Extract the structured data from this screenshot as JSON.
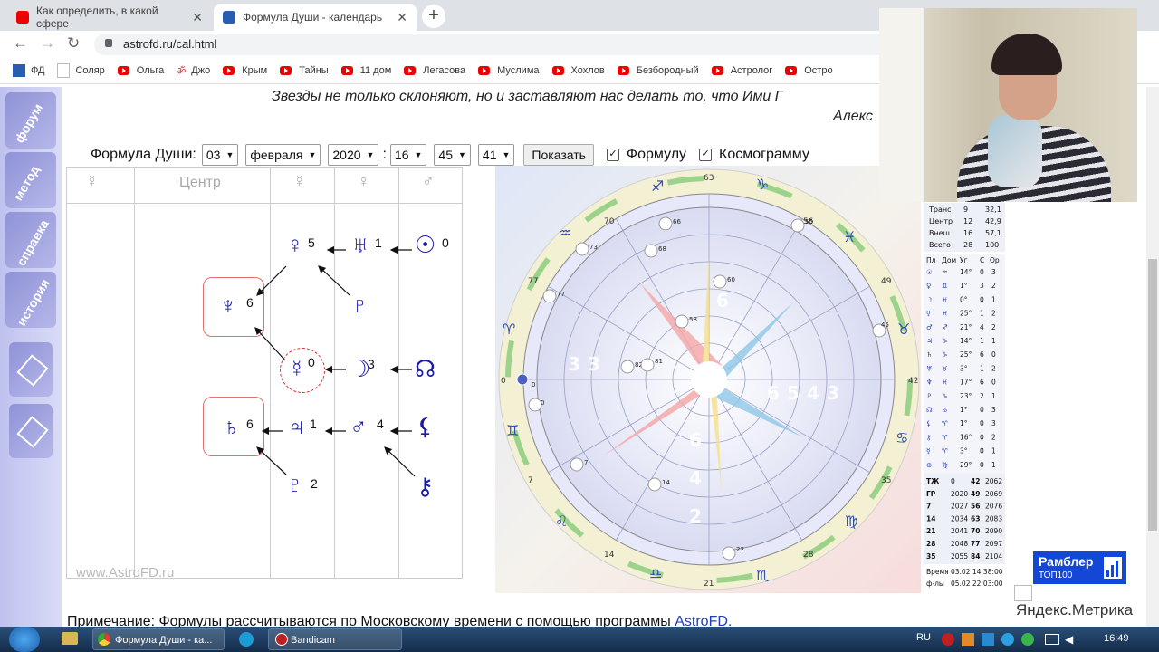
{
  "tabs": [
    {
      "label": "Как определить, в какой сфере",
      "close": "✕"
    },
    {
      "label": "Формула Души - календарь",
      "close": "✕"
    }
  ],
  "new_tab": "+",
  "address": "astrofd.ru/cal.html",
  "bookmarks": [
    "ФД",
    "Соляр",
    "Ольга",
    "Джо",
    "Крым",
    "Тайны",
    "11 дом",
    "Легасова",
    "Муслима",
    "Хохлов",
    "Безбородный",
    "Астролог",
    "Остро"
  ],
  "nav": [
    "форум",
    "метод",
    "справка",
    "история"
  ],
  "motto": {
    "line1": "Звезды не только склоняют, но и заставляют нас делать то, что Ими Г",
    "line2": "Алекс"
  },
  "form": {
    "label": "Формула Души:",
    "day": "03",
    "month": "февраля",
    "year": "2020",
    "hour": "16",
    "minute": "45",
    "second": "41",
    "colon": ":",
    "show_button": "Показать",
    "check_formula": "Формулу",
    "check_cosmo": "Космограмму"
  },
  "grid": {
    "headers": [
      "☿",
      "Центр",
      "☿",
      "♀",
      "♂"
    ],
    "cells": [
      {
        "g": "♀",
        "n": "5"
      },
      {
        "g": "♅",
        "n": "1"
      },
      {
        "g": "☉",
        "n": "0"
      },
      {
        "g": "♆",
        "n": "6"
      },
      {
        "g": "♇",
        "n": ""
      },
      {
        "g": "☿",
        "n": "0"
      },
      {
        "g": "☽",
        "n": "3"
      },
      {
        "g": "☊",
        "n": ""
      },
      {
        "g": "♄",
        "n": "6"
      },
      {
        "g": "♃",
        "n": "1"
      },
      {
        "g": "♂",
        "n": "4"
      },
      {
        "g": "⚸",
        "n": ""
      },
      {
        "g": "♇",
        "n": "2"
      },
      {
        "g": "⚷",
        "n": ""
      }
    ],
    "watermark": "www.AstroFD.ru"
  },
  "chart": {
    "signs": [
      "♐",
      "♑",
      "♒",
      "♓",
      "♈",
      "♉",
      "♊",
      "♋",
      "♌",
      "♍",
      "♎",
      "♏"
    ],
    "degrees": [
      "63",
      "70",
      "77",
      "0",
      "7",
      "14",
      "21",
      "28",
      "35",
      "42",
      "49",
      "56"
    ],
    "numbers": [
      "6",
      "5",
      "4",
      "3",
      "2"
    ],
    "planet_labels": [
      "66",
      "73",
      "68",
      "60",
      "77",
      "58",
      "82",
      "81",
      "0",
      "0",
      "7",
      "14",
      "22",
      "45",
      "55"
    ]
  },
  "stats": {
    "top": [
      [
        "Транс",
        "9",
        "32,1"
      ],
      [
        "Центр",
        "12",
        "42,9"
      ],
      [
        "Внеш",
        "16",
        "57,1"
      ],
      [
        "Всего",
        "28",
        "100"
      ]
    ],
    "header": [
      "Пл",
      "Дом",
      "Уг",
      "С",
      "Ор"
    ],
    "planets": [
      [
        "☉",
        "♒",
        "14°",
        "0",
        "3"
      ],
      [
        "♀",
        "♊",
        "1°",
        "3",
        "2"
      ],
      [
        "☽",
        "♓",
        "0°",
        "0",
        "1"
      ],
      [
        "☿",
        "♓",
        "25°",
        "1",
        "2"
      ],
      [
        "♂",
        "♐",
        "21°",
        "4",
        "2"
      ],
      [
        "♃",
        "♑",
        "14°",
        "1",
        "1"
      ],
      [
        "♄",
        "♑",
        "25°",
        "6",
        "0"
      ],
      [
        "♅",
        "♉",
        "3°",
        "1",
        "2"
      ],
      [
        "♆",
        "♓",
        "17°",
        "6",
        "0"
      ],
      [
        "♇",
        "♑",
        "23°",
        "2",
        "1"
      ],
      [
        "☊",
        "♋",
        "1°",
        "0",
        "3"
      ],
      [
        "⚸",
        "♈",
        "1°",
        "0",
        "3"
      ],
      [
        "⚷",
        "♈",
        "16°",
        "0",
        "2"
      ],
      [
        "☿",
        "♈",
        "3°",
        "0",
        "1"
      ],
      [
        "⊕",
        "♍",
        "29°",
        "0",
        "1"
      ]
    ],
    "years": [
      [
        "ТЖ",
        "0",
        "42",
        "2062"
      ],
      [
        "ГР",
        "2020",
        "49",
        "2069"
      ],
      [
        "7",
        "2027",
        "56",
        "2076"
      ],
      [
        "14",
        "2034",
        "63",
        "2083"
      ],
      [
        "21",
        "2041",
        "70",
        "2090"
      ],
      [
        "28",
        "2048",
        "77",
        "2097"
      ],
      [
        "35",
        "2055",
        "84",
        "2104"
      ]
    ],
    "time": [
      [
        "Время",
        "03.02 14:38:00"
      ],
      [
        "ф-лы",
        "05.02 22:03:00"
      ]
    ]
  },
  "rambler": {
    "line1": "Рамблер",
    "line2": "ТОП100"
  },
  "yandex": "Яндекс.Метрика",
  "note": {
    "text": "Примечание: Формулы рассчитываются по Московскому времени с помощью программы ",
    "link": "AstroFD."
  },
  "taskbar": {
    "items": [
      "Формула Души - ка...",
      "Bandicam"
    ],
    "lang": "RU",
    "clock": "16:49"
  }
}
